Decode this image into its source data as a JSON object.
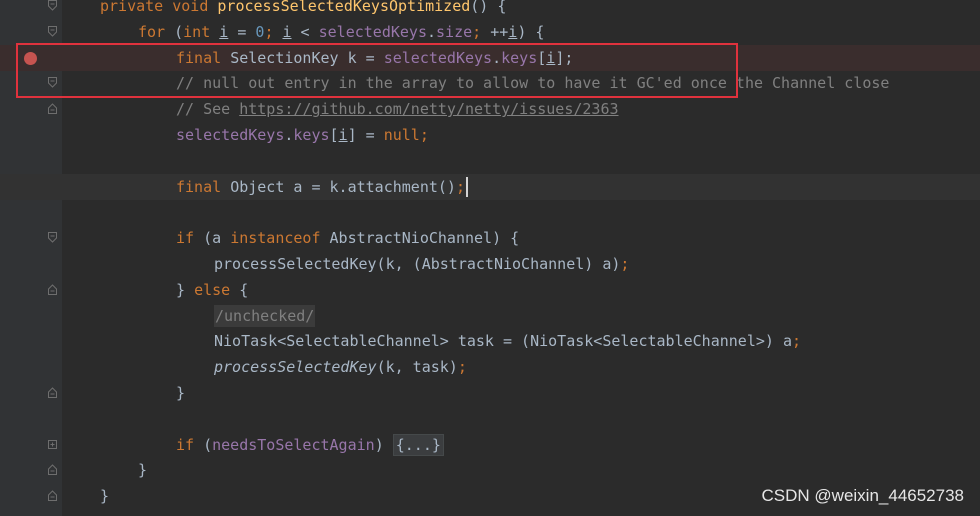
{
  "editor": {
    "lines": [
      {
        "tokens": [
          {
            "t": "private void ",
            "c": "kw"
          },
          {
            "t": "processSelectedKeysOptimized",
            "c": "fn"
          },
          {
            "t": "() {",
            "c": ""
          }
        ]
      },
      {
        "tokens": [
          {
            "t": "for ",
            "c": "kw"
          },
          {
            "t": "(",
            "c": ""
          },
          {
            "t": "int ",
            "c": "kw"
          },
          {
            "t": "i",
            "c": "ul"
          },
          {
            "t": " = ",
            "c": ""
          },
          {
            "t": "0",
            "c": "num"
          },
          {
            "t": "; ",
            "c": "kw"
          },
          {
            "t": "i",
            "c": "ul"
          },
          {
            "t": " < ",
            "c": ""
          },
          {
            "t": "selectedKeys",
            "c": "field"
          },
          {
            "t": ".",
            "c": ""
          },
          {
            "t": "size",
            "c": "field"
          },
          {
            "t": "; ",
            "c": "kw"
          },
          {
            "t": "++",
            "c": ""
          },
          {
            "t": "i",
            "c": "ul"
          },
          {
            "t": ") {",
            "c": ""
          }
        ]
      },
      {
        "tokens": [
          {
            "t": "final ",
            "c": "kw"
          },
          {
            "t": "SelectionKey k = ",
            "c": ""
          },
          {
            "t": "selectedKeys",
            "c": "field"
          },
          {
            "t": ".",
            "c": ""
          },
          {
            "t": "keys",
            "c": "field"
          },
          {
            "t": "[",
            "c": ""
          },
          {
            "t": "i",
            "c": "ul"
          },
          {
            "t": "];",
            "c": ""
          }
        ]
      },
      {
        "tokens": [
          {
            "t": "// null out entry in the array to allow to have it GC'ed once the Channel close",
            "c": "cmt"
          }
        ]
      },
      {
        "tokens": [
          {
            "t": "// See ",
            "c": "cmt"
          },
          {
            "t": "https://github.com/netty/netty/issues/2363",
            "c": "link"
          }
        ]
      },
      {
        "tokens": [
          {
            "t": "selectedKeys",
            "c": "field"
          },
          {
            "t": ".",
            "c": ""
          },
          {
            "t": "keys",
            "c": "field"
          },
          {
            "t": "[",
            "c": ""
          },
          {
            "t": "i",
            "c": "ul"
          },
          {
            "t": "] = ",
            "c": ""
          },
          {
            "t": "null",
            "c": "kw"
          },
          {
            "t": ";",
            "c": "kw"
          }
        ]
      },
      {
        "tokens": []
      },
      {
        "tokens": [
          {
            "t": "final ",
            "c": "kw"
          },
          {
            "t": "Object a = k.attachment()",
            "c": ""
          },
          {
            "t": ";",
            "c": "kw"
          }
        ]
      },
      {
        "tokens": []
      },
      {
        "tokens": [
          {
            "t": "if ",
            "c": "kw"
          },
          {
            "t": "(a ",
            "c": ""
          },
          {
            "t": "instanceof ",
            "c": "kw"
          },
          {
            "t": "AbstractNioChannel) {",
            "c": ""
          }
        ]
      },
      {
        "tokens": [
          {
            "t": "processSelectedKey(k, (AbstractNioChannel) a)",
            "c": ""
          },
          {
            "t": ";",
            "c": "kw"
          }
        ]
      },
      {
        "tokens": [
          {
            "t": "} ",
            "c": ""
          },
          {
            "t": "else ",
            "c": "kw"
          },
          {
            "t": "{",
            "c": ""
          }
        ]
      },
      {
        "tokens": [
          {
            "t": "/unchecked/",
            "c": "insp"
          }
        ]
      },
      {
        "tokens": [
          {
            "t": "NioTask<SelectableChannel> task = (NioTask<SelectableChannel>) a",
            "c": ""
          },
          {
            "t": ";",
            "c": "kw"
          }
        ]
      },
      {
        "tokens": [
          {
            "t": "processSelectedKey",
            "c": "it"
          },
          {
            "t": "(k, task)",
            "c": ""
          },
          {
            "t": ";",
            "c": "kw"
          }
        ]
      },
      {
        "tokens": [
          {
            "t": "}",
            "c": ""
          }
        ]
      },
      {
        "tokens": []
      },
      {
        "tokens": [
          {
            "t": "if ",
            "c": "kw"
          },
          {
            "t": "(",
            "c": ""
          },
          {
            "t": "needsToSelectAgain",
            "c": "field"
          },
          {
            "t": ") ",
            "c": ""
          },
          {
            "t": "{...}",
            "c": "folded"
          }
        ]
      },
      {
        "tokens": [
          {
            "t": "}",
            "c": ""
          }
        ]
      },
      {
        "tokens": [
          {
            "t": "}",
            "c": ""
          }
        ]
      }
    ],
    "indents": [
      38,
      76,
      114,
      114,
      114,
      114,
      0,
      114,
      0,
      114,
      152,
      114,
      152,
      152,
      152,
      114,
      0,
      114,
      76,
      38
    ]
  },
  "gutter": {
    "breakpoint_line": 2,
    "fold_markers": [
      {
        "line": 0,
        "kind": "open"
      },
      {
        "line": 1,
        "kind": "open"
      },
      {
        "line": 3,
        "kind": "open"
      },
      {
        "line": 4,
        "kind": "close"
      },
      {
        "line": 9,
        "kind": "open"
      },
      {
        "line": 11,
        "kind": "close"
      },
      {
        "line": 15,
        "kind": "close"
      },
      {
        "line": 17,
        "kind": "plus"
      },
      {
        "line": 18,
        "kind": "close"
      },
      {
        "line": 19,
        "kind": "close"
      }
    ]
  },
  "highlight": {
    "breakpoint_line_bg": "#3a2d2d",
    "caret_line": 7,
    "selection_color": "#e0323d"
  },
  "watermark": "CSDN @weixin_44652738"
}
